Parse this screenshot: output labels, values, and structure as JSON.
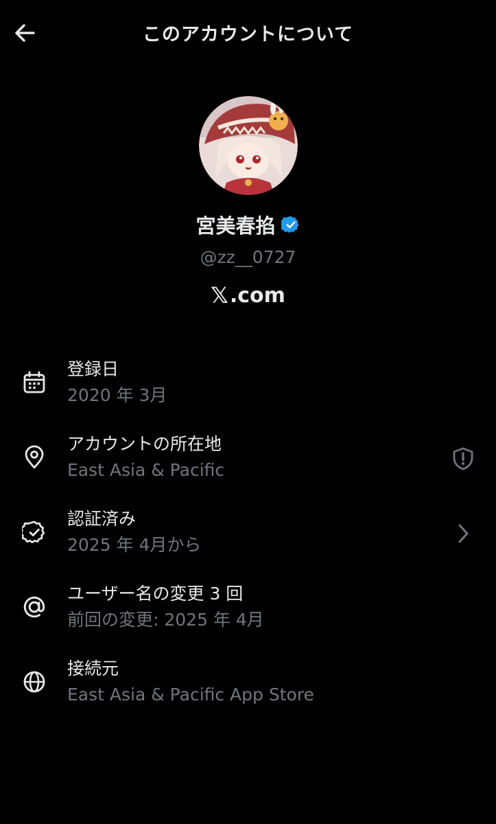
{
  "header": {
    "title": "このアカウントについて",
    "back_icon": "arrow-left-icon"
  },
  "profile": {
    "display_name": "宮美春掐",
    "handle": "@zz__0727",
    "verified": true,
    "verified_color": "#1d9bf0",
    "domain_logo": "𝕏",
    "domain_suffix": ".com"
  },
  "rows": [
    {
      "icon": "calendar-icon",
      "label": "登録日",
      "value": "2020 年 3月"
    },
    {
      "icon": "location-pin-icon",
      "label": "アカウントの所在地",
      "value": "East Asia & Pacific",
      "right_icon": "shield-alert-icon"
    },
    {
      "icon": "verified-badge-icon",
      "label": "認証済み",
      "value": "2025 年 4月から",
      "right_icon": "chevron-right-icon"
    },
    {
      "icon": "at-sign-icon",
      "label": "ユーザー名の変更 3 回",
      "value": "前回の変更: 2025 年 4月"
    },
    {
      "icon": "globe-icon",
      "label": "接続元",
      "value": "East Asia & Pacific App Store"
    }
  ],
  "colors": {
    "background": "#000000",
    "primary_text": "#e7e9ea",
    "secondary_text": "#71767b"
  }
}
